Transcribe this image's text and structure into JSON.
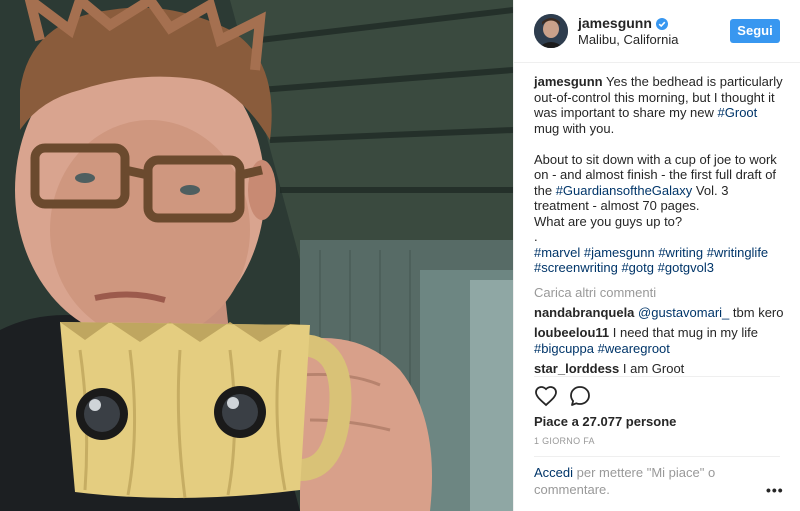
{
  "post": {
    "username": "jamesgunn",
    "location": "Malibu, California",
    "follow_label": "Segui",
    "caption": {
      "user": "jamesgunn",
      "text1": " Yes the bedhead is particularly out-of-control this morning, but I thought it was important to share my new ",
      "tag1": "#Groot",
      "text2": " mug with you.",
      "text3": "About to sit down with a cup of joe to work on - and almost finish - the first full draft of the ",
      "tag2": "#GuardiansoftheGalaxy",
      "text4": " Vol. 3 treatment - almost 70 pages.",
      "text5": "What are you guys up to?",
      "text6": ".",
      "hashtags": [
        "#marvel",
        "#jamesgunn",
        "#writing",
        "#writinglife",
        "#screenwriting",
        "#gotg",
        "#gotgvol3"
      ]
    },
    "load_more": "Carica altri commenti",
    "comments": [
      {
        "user": "nandabranquela",
        "mention": "@gustavomari_",
        "text": " tbm kero"
      },
      {
        "user": "loubeelou11",
        "text": " I need that mug in my life ",
        "tags": [
          "#bigcuppa",
          "#wearegroot"
        ]
      },
      {
        "user": "star_lorddess",
        "text": " I am Groot"
      }
    ],
    "likes": "Piace a 27.077 persone",
    "date": "1 GIORNO FA",
    "login": {
      "link": "Accedi",
      "text": " per mettere \"Mi piace\" o commentare."
    },
    "more_label": "•••",
    "icons": {
      "like": "heart-icon",
      "comment": "speech-bubble-icon",
      "verified": "verified-badge-icon",
      "more": "more-options-icon"
    },
    "colors": {
      "follow_button": "#3897f0",
      "link": "#003569",
      "muted": "#999999",
      "text": "#262626"
    }
  }
}
